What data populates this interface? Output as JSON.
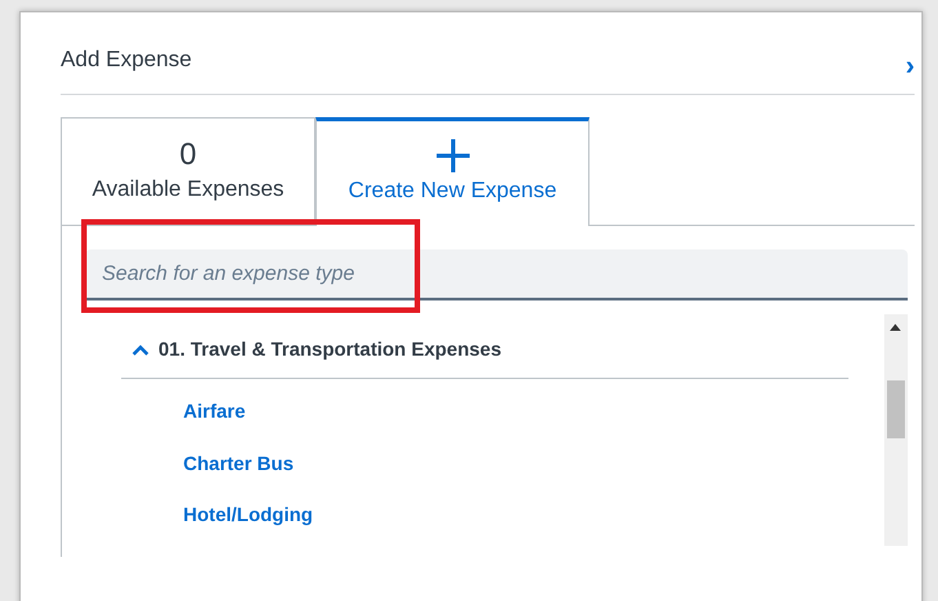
{
  "dialog": {
    "title": "Add Expense",
    "close_icon": "›"
  },
  "tabs": [
    {
      "count": "0",
      "label": "Available Expenses",
      "kind": "count",
      "selected": false
    },
    {
      "label": "Create New Expense",
      "kind": "add",
      "selected": true
    }
  ],
  "search": {
    "placeholder": "Search for an expense type",
    "highlighted": true
  },
  "groups": [
    {
      "label": "01. Travel & Transportation Expenses",
      "expanded": true,
      "children": [
        {
          "label": "Airfare"
        },
        {
          "label": "Charter Bus"
        },
        {
          "label": "Hotel/Lodging"
        }
      ]
    }
  ]
}
